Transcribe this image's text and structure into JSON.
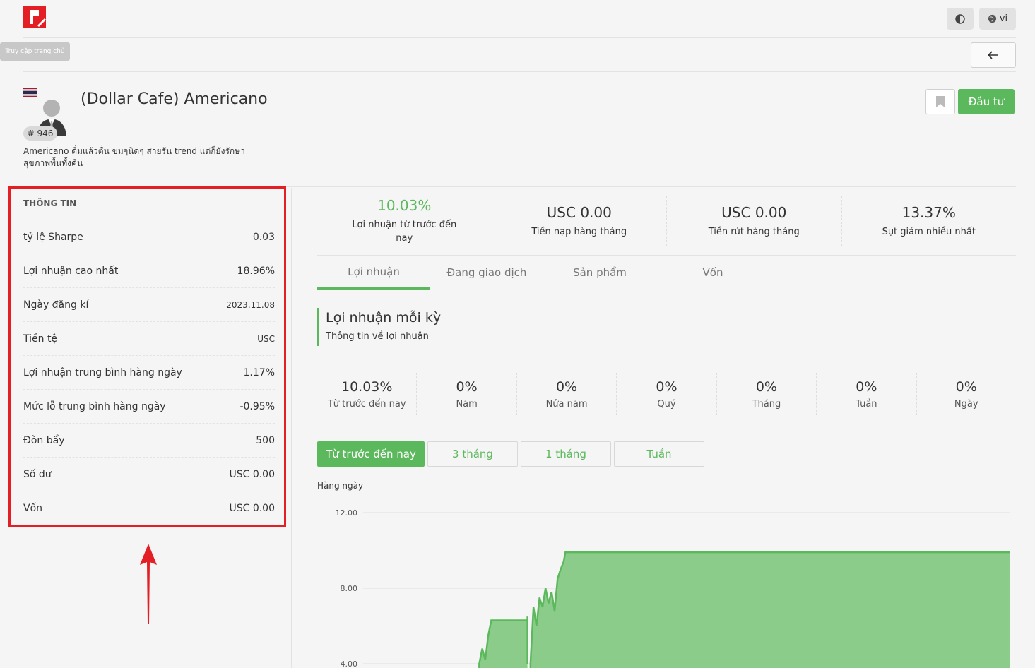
{
  "header": {
    "lang_label": "vi",
    "home_tooltip": "Truy cập trang chủ"
  },
  "profile": {
    "name": "(Dollar Cafe) Americano",
    "rank": "# 946",
    "description": "Americano ดื่มแล้วตื่น ขมๆนิดๆ สายรัน trend แต่ก็ยังรักษาสุขภาพพื้นทั้งคืน",
    "invest_label": "Đầu tư"
  },
  "info": {
    "title": "THÔNG TIN",
    "rows": [
      {
        "label": "tỷ lệ Sharpe",
        "value": "0.03"
      },
      {
        "label": "Lợi nhuận cao nhất",
        "value": "18.96%"
      },
      {
        "label": "Ngày đăng kí",
        "value": "2023.11.08"
      },
      {
        "label": "Tiền tệ",
        "value": "USC"
      },
      {
        "label": "Lợi nhuận trung bình hàng ngày",
        "value": "1.17%"
      },
      {
        "label": "Mức lỗ trung bình hàng ngày",
        "value": "-0.95%"
      },
      {
        "label": "Đòn bẩy",
        "value": "500"
      },
      {
        "label": "Số dư",
        "value": "USC 0.00"
      },
      {
        "label": "Vốn",
        "value": "USC 0.00"
      }
    ]
  },
  "stats": [
    {
      "value": "10.03%",
      "label": "Lợi nhuận từ trước đến nay"
    },
    {
      "value": "USC 0.00",
      "label": "Tiền nạp hàng tháng"
    },
    {
      "value": "USC 0.00",
      "label": "Tiền rút hàng tháng"
    },
    {
      "value": "13.37%",
      "label": "Sụt giảm nhiều nhất"
    }
  ],
  "tabs": [
    "Lợi nhuận",
    "Đang giao dịch",
    "Sản phẩm",
    "Vốn"
  ],
  "section": {
    "title": "Lợi nhuận mỗi kỳ",
    "subtitle": "Thông tin về lợi nhuận"
  },
  "periods": [
    {
      "value": "10.03%",
      "label": "Từ trước đến nay"
    },
    {
      "value": "0%",
      "label": "Năm"
    },
    {
      "value": "0%",
      "label": "Nửa năm"
    },
    {
      "value": "0%",
      "label": "Quý"
    },
    {
      "value": "0%",
      "label": "Tháng"
    },
    {
      "value": "0%",
      "label": "Tuần"
    },
    {
      "value": "0%",
      "label": "Ngày"
    }
  ],
  "ranges": [
    "Từ trước đến nay",
    "3 tháng",
    "1 tháng",
    "Tuần"
  ],
  "chart_caption": "Hàng ngày",
  "colors": {
    "accent": "#5cb85c",
    "highlight": "#e31e24",
    "chart_fill": "#8ccc8a"
  },
  "chart_data": {
    "type": "area",
    "ylabel": "",
    "y_ticks": [
      "12.00",
      "8.00",
      "4.00"
    ],
    "ylim": [
      4,
      12
    ],
    "x": [
      0.0,
      0.12,
      0.125,
      0.13,
      0.135,
      0.14,
      0.145,
      0.2,
      0.2,
      0.2,
      0.2,
      0.205,
      0.21,
      0.215,
      0.22,
      0.225,
      0.23,
      0.235,
      0.24,
      0.245,
      0.25,
      0.255,
      0.26,
      0.263,
      0.27,
      0.28,
      1.0
    ],
    "values": [
      null,
      4.0,
      4.8,
      4.2,
      5.5,
      6.3,
      6.3,
      6.3,
      6.5,
      4.0,
      null,
      4.0,
      7.0,
      6.0,
      7.5,
      7.0,
      8.0,
      7.2,
      7.8,
      6.8,
      8.5,
      9.0,
      9.4,
      9.9,
      9.9,
      9.9,
      9.9
    ]
  }
}
